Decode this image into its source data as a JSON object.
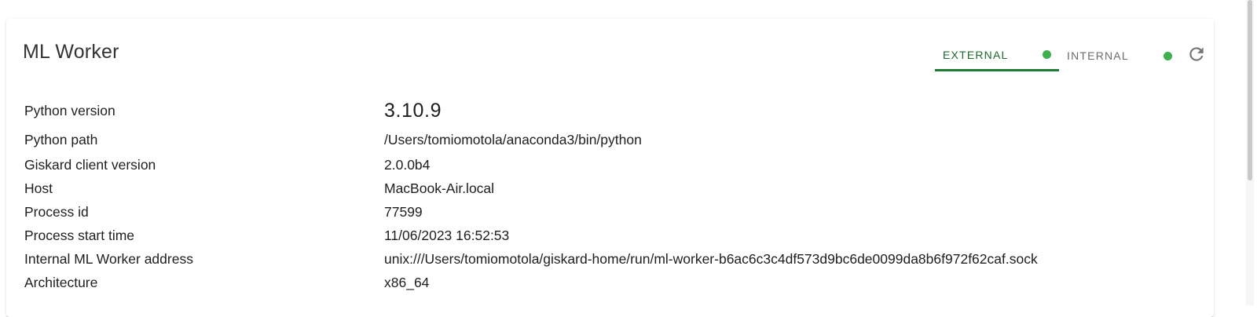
{
  "card": {
    "title": "ML Worker",
    "tabs": [
      {
        "label": "EXTERNAL",
        "active": true,
        "status_color": "#3bb04b"
      },
      {
        "label": "INTERNAL",
        "active": false,
        "status_color": "#3bb04b"
      }
    ],
    "refresh_icon": "refresh-icon"
  },
  "info": [
    {
      "key": "Python version",
      "value": "3.10.9"
    },
    {
      "key": "Python path",
      "value": "/Users/tomiomotola/anaconda3/bin/python"
    },
    {
      "key": "Giskard client version",
      "value": "2.0.0b4"
    },
    {
      "key": "Host",
      "value": "MacBook-Air.local"
    },
    {
      "key": "Process id",
      "value": "77599"
    },
    {
      "key": "Process start time",
      "value": "11/06/2023 16:52:53"
    },
    {
      "key": "Internal ML Worker address",
      "value": "unix:///Users/tomiomotola/giskard-home/run/ml-worker-b6ac6c3c4df573d9bc6de0099da8b6f972f62caf.sock"
    },
    {
      "key": "Architecture",
      "value": "x86_64"
    }
  ],
  "colors": {
    "accent": "#1f7a33",
    "status_online": "#3bb04b"
  }
}
